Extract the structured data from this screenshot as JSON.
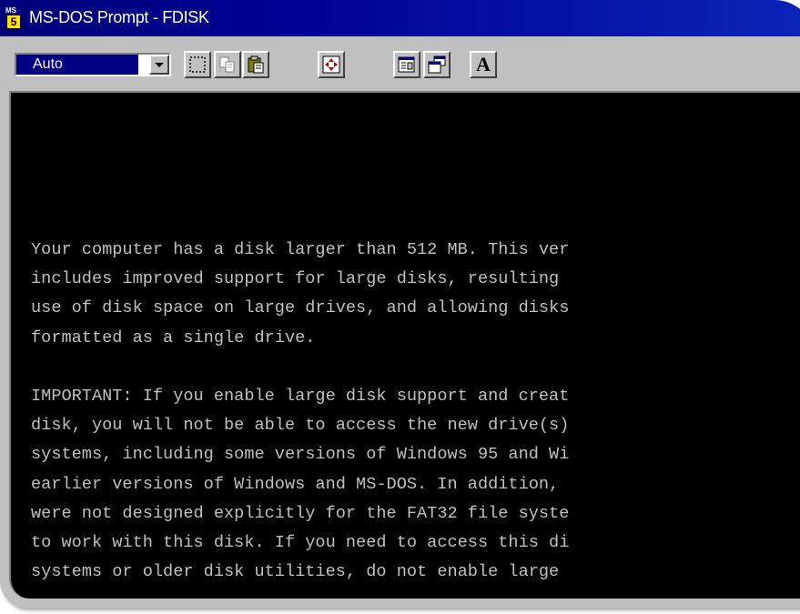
{
  "window": {
    "title": "MS-DOS Prompt - FDISK",
    "app_icon": "ms-dos-icon",
    "app_icon_text": "MS"
  },
  "toolbar": {
    "font_size_value": "Auto",
    "buttons": [
      {
        "name": "mark",
        "icon": "mark-icon"
      },
      {
        "name": "copy",
        "icon": "copy-icon"
      },
      {
        "name": "paste",
        "icon": "paste-icon"
      },
      {
        "name": "full-screen",
        "icon": "full-screen-icon"
      },
      {
        "name": "properties",
        "icon": "properties-icon"
      },
      {
        "name": "background",
        "icon": "background-icon"
      },
      {
        "name": "font",
        "icon": "font-icon",
        "label": "A"
      }
    ]
  },
  "console": {
    "lines": [
      "Your computer has a disk larger than 512 MB. This ver",
      "includes improved support for large disks, resulting",
      "use of disk space on large drives, and allowing disks",
      "formatted as a single drive.",
      "",
      "IMPORTANT: If you enable large disk support and creat",
      "disk, you will not be able to access the new drive(s)",
      "systems, including some versions of Windows 95 and Wi",
      "earlier versions of Windows and MS-DOS. In addition,",
      "were not designed explicitly for the FAT32 file syste",
      "to work with this disk. If you need to access this di",
      "systems or older disk utilities, do not enable large"
    ]
  },
  "colors": {
    "titlebar": "#000080",
    "console_background": "#000000",
    "console_text": "#c0c0c0",
    "chrome": "#c0c0c0"
  }
}
